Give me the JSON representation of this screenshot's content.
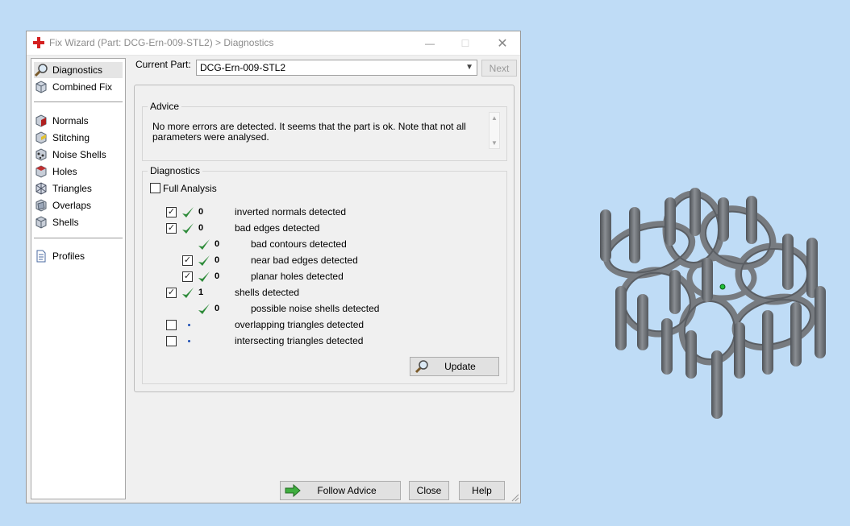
{
  "window": {
    "title": "Fix Wizard (Part: DCG-Ern-009-STL2) > Diagnostics",
    "minimize_symbol": "—",
    "maximize_symbol": "☐",
    "close_symbol": "✕"
  },
  "sidebar": {
    "items": [
      {
        "label": "Diagnostics",
        "icon": "magnifier-icon",
        "selected": true
      },
      {
        "label": "Combined Fix",
        "icon": "cube-icon"
      },
      {
        "label": "Normals",
        "icon": "normals-cube-icon"
      },
      {
        "label": "Stitching",
        "icon": "stitching-cube-icon"
      },
      {
        "label": "Noise Shells",
        "icon": "noise-shells-icon"
      },
      {
        "label": "Holes",
        "icon": "holes-cube-icon"
      },
      {
        "label": "Triangles",
        "icon": "triangles-cube-icon"
      },
      {
        "label": "Overlaps",
        "icon": "overlaps-cube-icon"
      },
      {
        "label": "Shells",
        "icon": "shells-cube-icon"
      },
      {
        "label": "Profiles",
        "icon": "document-icon"
      }
    ]
  },
  "current_part": {
    "label": "Current Part:",
    "value": "DCG-Ern-009-STL2",
    "next_label": "Next"
  },
  "advice": {
    "title": "Advice",
    "text": "No more errors are detected. It seems that the part is ok. Note that not all parameters were analysed."
  },
  "diagnostics": {
    "title": "Diagnostics",
    "full_analysis_label": "Full Analysis",
    "rows": [
      {
        "checkbox": true,
        "checked": true,
        "status": "ok",
        "count": "0",
        "label": "inverted normals detected"
      },
      {
        "checkbox": true,
        "checked": true,
        "status": "ok",
        "count": "0",
        "label": "bad edges detected"
      },
      {
        "checkbox": false,
        "status": "ok",
        "count": "0",
        "label": "bad contours detected"
      },
      {
        "checkbox": true,
        "checked": true,
        "status": "ok",
        "count": "0",
        "label": "near bad edges detected"
      },
      {
        "checkbox": true,
        "checked": true,
        "status": "ok",
        "count": "0",
        "label": "planar holes detected"
      },
      {
        "checkbox": true,
        "checked": true,
        "status": "ok",
        "count": "1",
        "label": "shells detected"
      },
      {
        "checkbox": false,
        "status": "ok",
        "count": "0",
        "label": "possible noise shells detected"
      },
      {
        "checkbox": true,
        "checked": false,
        "status": "pending",
        "count": "",
        "label": "overlapping triangles detected"
      },
      {
        "checkbox": true,
        "checked": false,
        "status": "pending",
        "count": "",
        "label": "intersecting triangles detected"
      }
    ],
    "update_label": "Update"
  },
  "footer": {
    "follow_advice_label": "Follow Advice",
    "close_label": "Close",
    "help_label": "Help"
  },
  "colors": {
    "check_green": "#2e8b3a",
    "desktop_bg": "#bfdcf6",
    "model_gray": "#6f7378"
  }
}
